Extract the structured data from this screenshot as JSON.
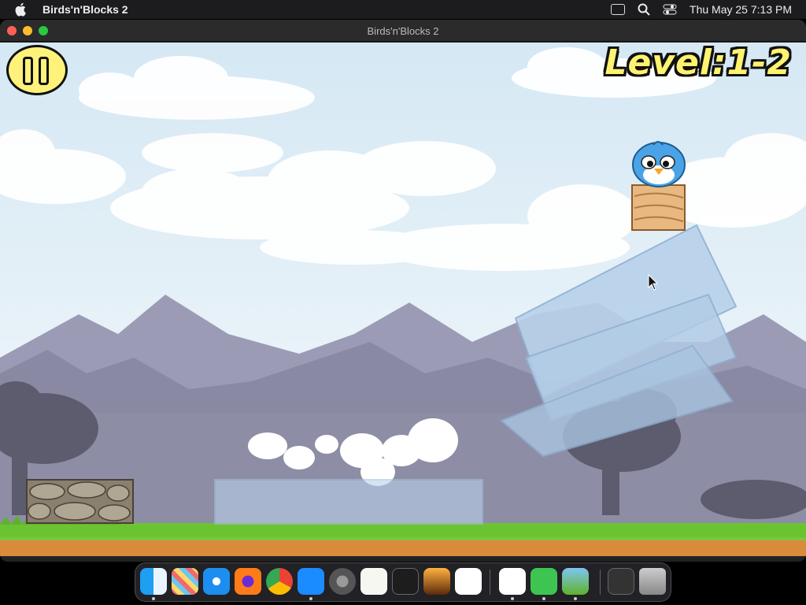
{
  "menubar": {
    "app_name": "Birds'n'Blocks 2",
    "datetime": "Thu May 25  7:13 PM",
    "icons": [
      "apple-icon",
      "screen-mirroring-icon",
      "search-icon",
      "control-center-icon"
    ]
  },
  "window": {
    "title": "Birds'n'Blocks 2",
    "traffic_lights": {
      "close": "#ff5f57",
      "minimize": "#febc2e",
      "zoom": "#28c840"
    }
  },
  "game": {
    "level_text": "Level:1-2",
    "pause_button": "pause-icon",
    "colors": {
      "sky": "#dbeaf5",
      "mountain": "#8e8da8",
      "ground": "#d98a3a",
      "grass": "#6cc332",
      "ice": "#b8d2ea",
      "wood": "#e8b880",
      "stone": "#8a8070",
      "bird": "#4aa3e6"
    }
  },
  "dock": {
    "apps": [
      "finder-icon",
      "launchpad-icon",
      "safari-icon",
      "firefox-icon",
      "chrome-icon",
      "app-store-icon",
      "system-settings-icon",
      "textedit-icon",
      "terminal-icon",
      "garageband-icon",
      "vscode-icon",
      "visual-studio-icon",
      "messages-icon",
      "birds-n-blocks-icon",
      "screenshot-icon",
      "trash-icon"
    ]
  }
}
